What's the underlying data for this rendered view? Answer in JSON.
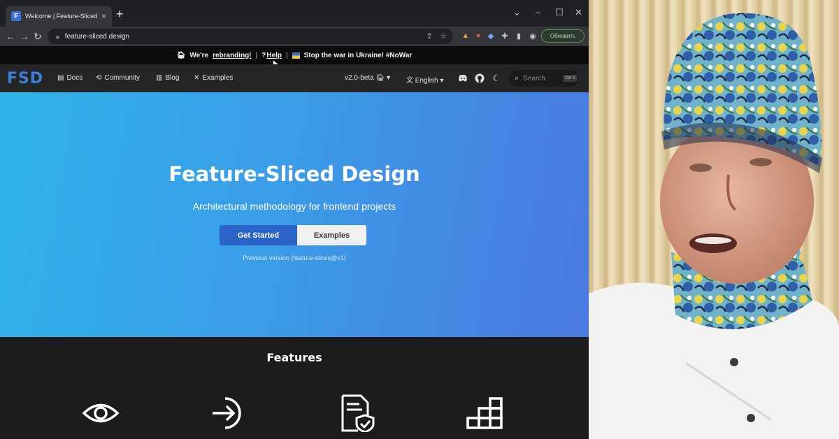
{
  "browser": {
    "tab_title": "Welcome | Feature-Sliced Design",
    "tab_favicon_letter": "F",
    "url": "feature-sliced.design",
    "update_label": "Обновить"
  },
  "announcement": {
    "rebrand_prefix": "We're",
    "rebrand_link": "rebranding!",
    "help_prefix": "?",
    "help_link": "Help",
    "war_text": "Stop the war in Ukraine! #NoWar",
    "separator": "|"
  },
  "site_nav": {
    "logo": "FSD",
    "links": [
      "Docs",
      "Community",
      "Blog",
      "Examples"
    ],
    "version": "v2.0-beta",
    "language": "English",
    "search_placeholder": "Search",
    "search_shortcut": "Ctrl K"
  },
  "hero": {
    "title": "Feature-Sliced Design",
    "subtitle": "Architectural methodology for frontend projects",
    "primary_button": "Get Started",
    "secondary_button": "Examples",
    "previous_version": "Previous version (feature-slices@v1)"
  },
  "features": {
    "title": "Features",
    "icons": [
      "eye-icon",
      "sign-in-icon",
      "shield-document-icon",
      "blocks-icon"
    ]
  },
  "colors": {
    "hero_start": "#2fb3e8",
    "hero_end": "#4a79e0",
    "primary_button": "#2c63c8",
    "logo": "#3b7fd9"
  }
}
